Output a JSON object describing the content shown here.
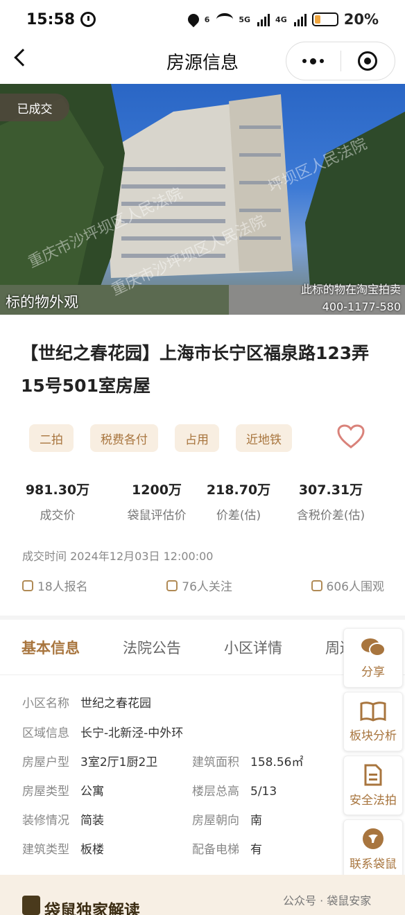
{
  "status_bar": {
    "time": "15:58",
    "battery": "20%",
    "net1": "5G",
    "net2": "4G",
    "wifi_badge": "6"
  },
  "nav": {
    "title": "房源信息"
  },
  "photo": {
    "badge": "已成交",
    "caption_left": "标的物外观",
    "caption_right": "此标的物在淘宝拍卖",
    "caption_phone": "400-1177-580",
    "watermarks": [
      "重庆市沙坪坝区人民法院",
      "重庆市沙坪坝区人民法院",
      "坪坝区人民法院"
    ]
  },
  "title": "【世纪之春花园】上海市长宁区福泉路123弄15号501室房屋",
  "tags": [
    "二拍",
    "税费各付",
    "占用",
    "近地铁"
  ],
  "stats": [
    {
      "value": "981.30万",
      "label": "成交价"
    },
    {
      "value": "1200万",
      "label": "袋鼠评估价"
    },
    {
      "value": "218.70万",
      "label": "价差(估)"
    },
    {
      "value": "307.31万",
      "label": "含税价差(估)"
    }
  ],
  "deal_time": "成交时间 2024年12月03日 12:00:00",
  "counts": {
    "signup": "18人报名",
    "follow": "76人关注",
    "watch": "606人围观"
  },
  "tabs": [
    "基本信息",
    "法院公告",
    "小区详情",
    "周边"
  ],
  "basic_info": {
    "community": {
      "label": "小区名称",
      "value": "世纪之春花园"
    },
    "area": {
      "label": "区域信息",
      "value": "长宁-北新泾-中外环"
    },
    "layout": {
      "label": "房屋户型",
      "value": "3室2厅1厨2卫"
    },
    "size": {
      "label": "建筑面积",
      "value": "158.56㎡"
    },
    "type": {
      "label": "房屋类型",
      "value": "公寓"
    },
    "floors": {
      "label": "楼层总高",
      "value": "5/13"
    },
    "decor": {
      "label": "装修情况",
      "value": "简装"
    },
    "facing": {
      "label": "房屋朝向",
      "value": "南"
    },
    "build_type": {
      "label": "建筑类型",
      "value": "板楼"
    },
    "elevator": {
      "label": "配备电梯",
      "value": "有"
    }
  },
  "side_buttons": {
    "share": "分享",
    "analysis": "板块分析",
    "safe": "安全法拍",
    "contact": "联系袋鼠"
  },
  "bottom": {
    "title": "袋鼠独家解读",
    "wechat": "公众号 · 袋鼠安家"
  },
  "colors": {
    "accent": "#a8753e",
    "tag_bg": "#f8eee1",
    "heart": "#d9827a"
  }
}
